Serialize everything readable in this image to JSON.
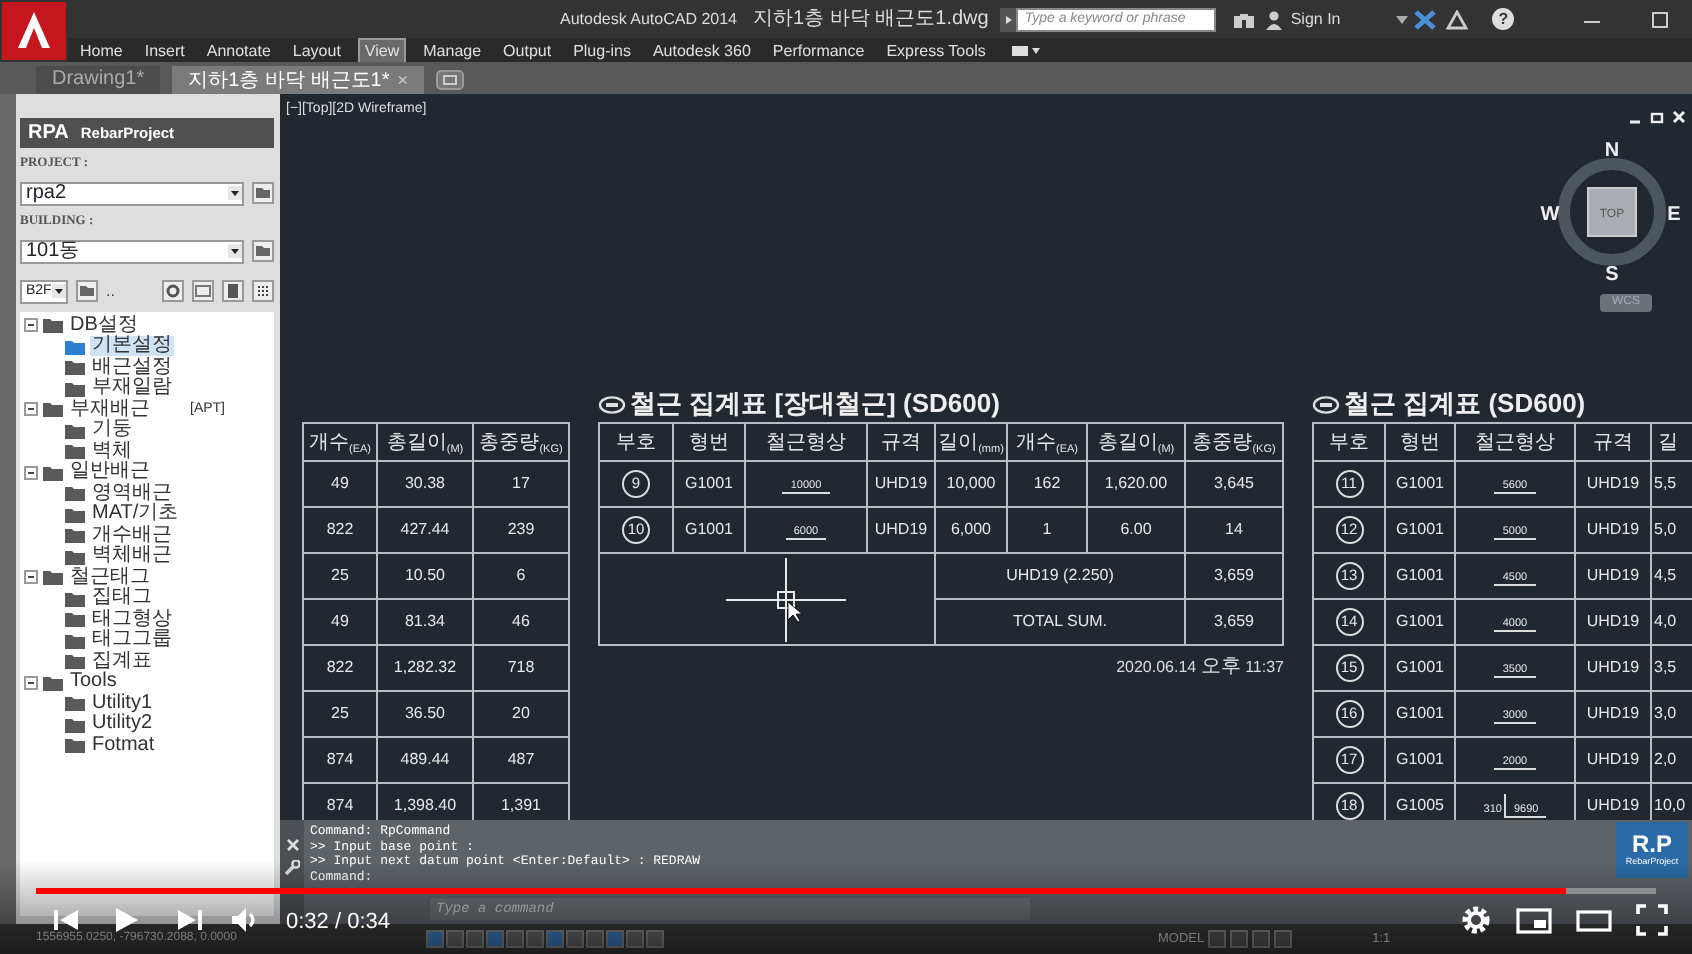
{
  "title_bar": {
    "app": "Autodesk AutoCAD 2014",
    "file": "지하1층 바닥 배근도1.dwg",
    "search_placeholder": "Type a keyword or phrase",
    "sign_in": "Sign In",
    "help": "?"
  },
  "ribbon_tabs": [
    {
      "label": "Home",
      "selected": false
    },
    {
      "label": "Insert",
      "selected": false
    },
    {
      "label": "Annotate",
      "selected": false
    },
    {
      "label": "Layout",
      "selected": false
    },
    {
      "label": "View",
      "selected": true
    },
    {
      "label": "Manage",
      "selected": false
    },
    {
      "label": "Output",
      "selected": false
    },
    {
      "label": "Plug-ins",
      "selected": false
    },
    {
      "label": "Autodesk 360",
      "selected": false
    },
    {
      "label": "Performance",
      "selected": false
    },
    {
      "label": "Express Tools",
      "selected": false
    }
  ],
  "doc_tabs": [
    {
      "label": "Drawing1*",
      "selected": false
    },
    {
      "label": "지하1층 바닥 배근도1*",
      "selected": true,
      "close": "×"
    }
  ],
  "panel": {
    "logo": "RPA",
    "title": "RebarProject",
    "project_label": "PROJECT :",
    "project": "rpa2",
    "building_label": "BUILDING :",
    "building": "101동",
    "floor": "B2F",
    "more": "..",
    "tree": [
      {
        "label": "DB설정",
        "selected": false,
        "expanded": true,
        "children": [
          {
            "label": "기본설정",
            "selected": true
          },
          {
            "label": "배근설정",
            "selected": false
          },
          {
            "label": "부재일람",
            "selected": false
          }
        ]
      },
      {
        "label": "부재배근",
        "note": "[APT]",
        "selected": false,
        "expanded": true,
        "children": [
          {
            "label": "기둥",
            "selected": false
          },
          {
            "label": "벽체",
            "selected": false
          }
        ]
      },
      {
        "label": "일반배근",
        "selected": false,
        "expanded": true,
        "children": [
          {
            "label": "영역배근",
            "selected": false
          },
          {
            "label": "MAT/기초",
            "selected": false
          },
          {
            "label": "개수배근",
            "selected": false
          },
          {
            "label": "벽체배근",
            "selected": false
          }
        ]
      },
      {
        "label": "철근태그",
        "selected": false,
        "expanded": true,
        "children": [
          {
            "label": "집태그",
            "selected": false
          },
          {
            "label": "태그형상",
            "selected": false
          },
          {
            "label": "태그그룹",
            "selected": false
          },
          {
            "label": "집계표",
            "selected": false
          }
        ]
      },
      {
        "label": "Tools",
        "selected": false,
        "expanded": true,
        "children": [
          {
            "label": "Utility1",
            "selected": false
          },
          {
            "label": "Utility2",
            "selected": false
          },
          {
            "label": "Fotmat",
            "selected": false
          }
        ]
      }
    ]
  },
  "viewport": {
    "label": "[−][Top][2D Wireframe]",
    "compass": {
      "n": "N",
      "w": "W",
      "e": "E",
      "s": "S",
      "top": "TOP",
      "wcs": "WCS"
    }
  },
  "tables": [
    {
      "columns": [
        "개수$_{(EA)}$",
        "총길이$_{(M)}$",
        "총중량$_{(KG)}$"
      ],
      "rows": [
        {
          "values": [
            "49",
            "30.38",
            "17"
          ]
        },
        {
          "values": [
            "822",
            "427.44",
            "239"
          ]
        },
        {
          "values": [
            "25",
            "10.50",
            "6"
          ]
        },
        {
          "values": [
            "49",
            "81.34",
            "46"
          ]
        },
        {
          "values": [
            "822",
            "1,282.32",
            "718"
          ]
        },
        {
          "values": [
            "25",
            "36.50",
            "20"
          ]
        },
        {
          "values": [
            "874",
            "489.44",
            "487"
          ]
        },
        {
          "values": [
            "874",
            "1,398.40",
            "1,391"
          ]
        }
      ]
    },
    {
      "title": "철근 집계표 [장대철근] (SD600)",
      "columns": [
        "부호",
        "형번",
        "철근형상",
        "규격",
        "길이$_{(mm)}$",
        "개수$_{(EA)}$",
        "총길이$_{(M)}$",
        "총중량$_{(KG)}$"
      ],
      "rows": [
        {
          "mark": "9",
          "type": "G1001",
          "shape": {
            "length": "10000"
          },
          "spec": "UHD19",
          "values": [
            "10,000",
            "162",
            "1,620.00",
            "3,645"
          ]
        },
        {
          "mark": "10",
          "type": "G1001",
          "shape": {
            "length": "6000"
          },
          "spec": "UHD19",
          "values": [
            "6,000",
            "1",
            "6.00",
            "14"
          ]
        }
      ],
      "summary": [
        {
          "label": "UHD19 (2.250)",
          "value": "3,659"
        },
        {
          "label": "TOTAL SUM.",
          "value": "3,659"
        }
      ],
      "date": "2020.06.14",
      "ampm": "오후",
      "time": "11:37"
    },
    {
      "title": "철근 집계표 (SD600)",
      "columns": [
        "부호",
        "형번",
        "철근형상",
        "규격",
        "길"
      ],
      "rows": [
        {
          "mark": "11",
          "type": "G1001",
          "shape": {
            "length": "5600"
          },
          "spec": "UHD19",
          "values": [
            "5,5"
          ]
        },
        {
          "mark": "12",
          "type": "G1001",
          "shape": {
            "length": "5000"
          },
          "spec": "UHD19",
          "values": [
            "5,0"
          ]
        },
        {
          "mark": "13",
          "type": "G1001",
          "shape": {
            "length": "4500"
          },
          "spec": "UHD19",
          "values": [
            "4,5"
          ]
        },
        {
          "mark": "14",
          "type": "G1001",
          "shape": {
            "length": "4000"
          },
          "spec": "UHD19",
          "values": [
            "4,0"
          ]
        },
        {
          "mark": "15",
          "type": "G1001",
          "shape": {
            "length": "3500"
          },
          "spec": "UHD19",
          "values": [
            "3,5"
          ]
        },
        {
          "mark": "16",
          "type": "G1001",
          "shape": {
            "length": "3000"
          },
          "spec": "UHD19",
          "values": [
            "3,0"
          ]
        },
        {
          "mark": "17",
          "type": "G1001",
          "shape": {
            "length": "2000"
          },
          "spec": "UHD19",
          "values": [
            "2,0"
          ]
        },
        {
          "mark": "18",
          "type": "G1005",
          "shape": {
            "hook": "310",
            "length": "9690"
          },
          "spec": "UHD19",
          "values": [
            "10,0"
          ]
        }
      ]
    }
  ],
  "command_line": {
    "history": [
      "Command: RpCommand",
      ">> Input base point :",
      ">> Input next datum point <Enter:Default> :  REDRAW",
      "Command:"
    ],
    "placeholder": "Type a command"
  },
  "status_bar": {
    "coordinates": "1556955.0250, -796730.2088, 0.0000",
    "model": "MODEL",
    "scale": "1:1"
  },
  "logo": {
    "text": "R.P",
    "sub": "RebarProject"
  },
  "player": {
    "level": 0.944,
    "time": "0:32 / 0:34"
  }
}
